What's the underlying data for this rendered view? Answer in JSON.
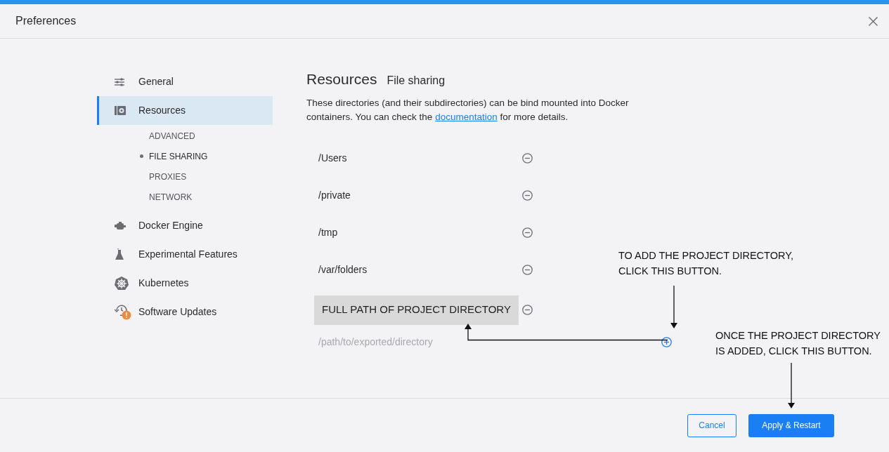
{
  "window": {
    "title": "Preferences"
  },
  "sidebar": {
    "items": [
      {
        "label": "General",
        "selected": false
      },
      {
        "label": "Resources",
        "selected": true,
        "children": [
          {
            "label": "ADVANCED",
            "selected": false
          },
          {
            "label": "FILE SHARING",
            "selected": true
          },
          {
            "label": "PROXIES",
            "selected": false
          },
          {
            "label": "NETWORK",
            "selected": false
          }
        ]
      },
      {
        "label": "Docker Engine",
        "selected": false
      },
      {
        "label": "Experimental Features",
        "selected": false
      },
      {
        "label": "Kubernetes",
        "selected": false
      },
      {
        "label": "Software Updates",
        "selected": false
      }
    ]
  },
  "content": {
    "title": "Resources",
    "subtitle": "File sharing",
    "description_before": "These directories (and their subdirectories) can be bind mounted into Docker containers. You can check the ",
    "link": "documentation",
    "description_after": " for more details.",
    "directories": [
      {
        "path": "/Users",
        "kind": "plain"
      },
      {
        "path": "/private",
        "kind": "plain"
      },
      {
        "path": "/tmp",
        "kind": "plain"
      },
      {
        "path": "/var/folders",
        "kind": "plain"
      },
      {
        "path": "FULL PATH OF PROJECT DIRECTORY",
        "kind": "highlighted"
      }
    ],
    "new_directory": {
      "placeholder": "/path/to/exported/directory"
    }
  },
  "annotations": [
    "TO ADD THE PROJECT DIRECTORY, CLICK THIS BUTTON.",
    "ONCE THE PROJECT DIRECTORY IS ADDED, CLICK THIS BUTTON."
  ],
  "buttons": {
    "cancel": "Cancel",
    "apply": "Apply & Restart"
  }
}
